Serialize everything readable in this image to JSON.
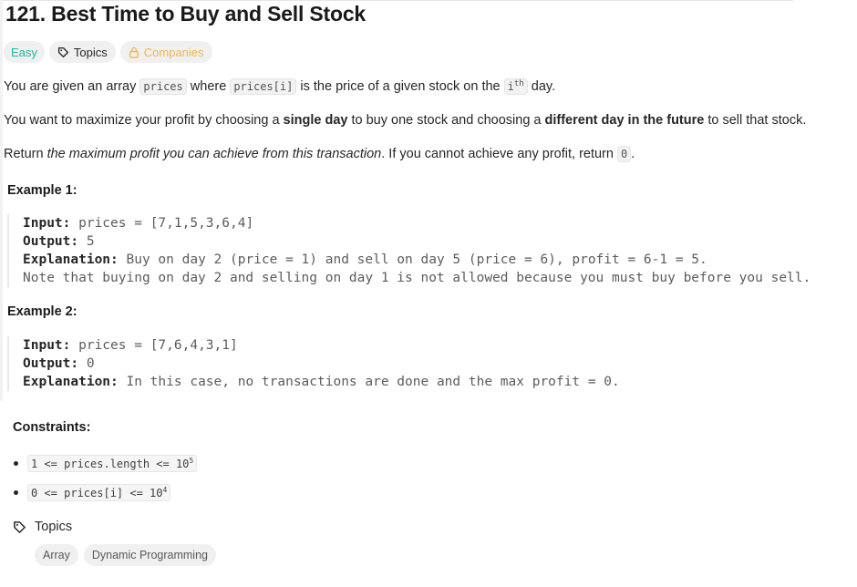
{
  "problem": {
    "title": "121. Best Time to Buy and Sell Stock",
    "difficulty": "Easy",
    "topics_label": "Topics",
    "companies_label": "Companies"
  },
  "description": {
    "p1_a": "You are given an array ",
    "p1_code1": "prices",
    "p1_b": " where ",
    "p1_code2": "prices[i]",
    "p1_c": " is the price of a given stock on the ",
    "p1_code3": "i",
    "p1_sup": "th",
    "p1_d": " day.",
    "p2_a": "You want to maximize your profit by choosing a ",
    "p2_bold1": "single day",
    "p2_b": " to buy one stock and choosing a ",
    "p2_bold2": "different day in the future",
    "p2_c": " to sell that stock.",
    "p3_a": "Return ",
    "p3_ital": "the maximum profit you can achieve from this transaction",
    "p3_b": ". If you cannot achieve any profit, return ",
    "p3_code": "0",
    "p3_c": "."
  },
  "examples": [
    {
      "heading": "Example 1:",
      "input_label": "Input:",
      "input_value": " prices = [7,1,5,3,6,4]",
      "output_label": "Output:",
      "output_value": " 5",
      "explanation_label": "Explanation:",
      "explanation_value": " Buy on day 2 (price = 1) and sell on day 5 (price = 6), profit = 6-1 = 5.",
      "note": "Note that buying on day 2 and selling on day 1 is not allowed because you must buy before you sell."
    },
    {
      "heading": "Example 2:",
      "input_label": "Input:",
      "input_value": " prices = [7,6,4,3,1]",
      "output_label": "Output:",
      "output_value": " 0",
      "explanation_label": "Explanation:",
      "explanation_value": " In this case, no transactions are done and the max profit = 0."
    }
  ],
  "constraints": {
    "heading": "Constraints:",
    "items": [
      {
        "text": "1 <= prices.length <= 10",
        "sup": "5"
      },
      {
        "text": "0 <= prices[i] <= 10",
        "sup": "4"
      }
    ]
  },
  "topics": {
    "label": "Topics",
    "items": [
      "Array",
      "Dynamic Programming"
    ]
  },
  "colors": {
    "easy": "#1fb7a6",
    "companies": "#f3b450",
    "pill_bg": "#f0f0f0"
  },
  "icons": {
    "topics_tag": "tag-icon",
    "companies_lock": "lock-icon"
  }
}
